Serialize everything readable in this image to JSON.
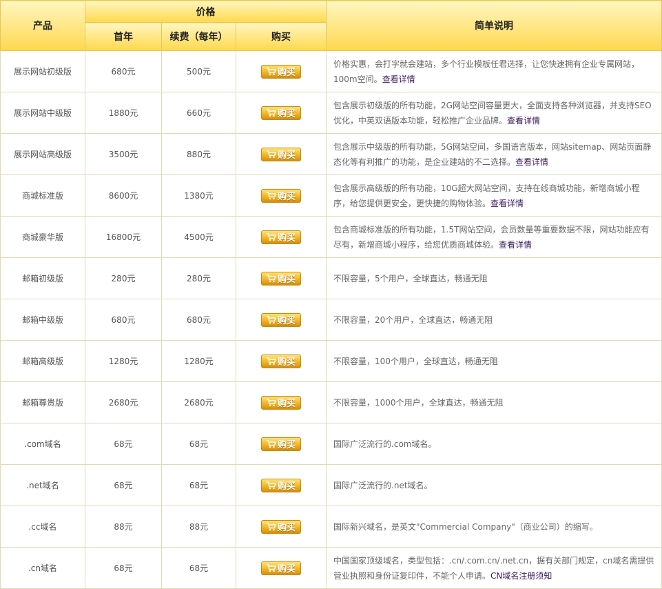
{
  "header": {
    "product": "产品",
    "price": "价格",
    "first_year": "首年",
    "renewal": "续费（每年）",
    "buy": "购买",
    "desc": "简单说明"
  },
  "buy_label": "购买",
  "rows": [
    {
      "name": "展示网站初级版",
      "first": "680元",
      "renew": "500元",
      "desc": "价格实惠，会打字就会建站，多个行业模板任君选择，让您快速拥有企业专属网站，100m空间。",
      "link": "查看详情"
    },
    {
      "name": "展示网站中级版",
      "first": "1880元",
      "renew": "660元",
      "desc": "包含展示初级版的所有功能，2G网站空间容量更大，全面支持各种浏览器，并支持SEO优化，中英双语版本功能，轻松推广企业品牌。",
      "link": "查看详情"
    },
    {
      "name": "展示网站高级版",
      "first": "3500元",
      "renew": "880元",
      "desc": "包含展示中级版的所有功能，5G网站空间，多国语言版本，网站sitemap、网站页面静态化等有利推广的功能，是企业建站的不二选择。",
      "link": "查看详情"
    },
    {
      "name": "商城标准版",
      "first": "8600元",
      "renew": "1380元",
      "desc": "包含展示高级版的所有功能，10G超大网站空间，支持在线商城功能，新增商城小程序，给您提供更安全，更快捷的购物体验。",
      "link": "查看详情"
    },
    {
      "name": "商城豪华版",
      "first": "16800元",
      "renew": "4500元",
      "desc": "包含商城标准版的所有功能，1.5T网站空间，会员数量等重要数据不限，网站功能应有尽有，新增商城小程序，给您优质商城体验。",
      "link": "查看详情"
    },
    {
      "name": "邮箱初级版",
      "first": "280元",
      "renew": "280元",
      "desc": "不限容量，5个用户，全球直达，畅通无阻",
      "link": ""
    },
    {
      "name": "邮箱中级版",
      "first": "680元",
      "renew": "680元",
      "desc": "不限容量，20个用户，全球直达，畅通无阻",
      "link": ""
    },
    {
      "name": "邮箱高级版",
      "first": "1280元",
      "renew": "1280元",
      "desc": "不限容量，100个用户，全球直达，畅通无阻",
      "link": ""
    },
    {
      "name": "邮箱尊贵版",
      "first": "2680元",
      "renew": "2680元",
      "desc": "不限容量，1000个用户，全球直达，畅通无阻",
      "link": ""
    },
    {
      "name": ".com域名",
      "first": "68元",
      "renew": "68元",
      "desc": "国际广泛流行的.com域名。",
      "link": ""
    },
    {
      "name": ".net域名",
      "first": "68元",
      "renew": "68元",
      "desc": "国际广泛流行的.net域名。",
      "link": ""
    },
    {
      "name": ".cc域名",
      "first": "88元",
      "renew": "88元",
      "desc": "国际新兴域名，是英文\"Commercial Company\"（商业公司）的缩写。",
      "link": ""
    },
    {
      "name": ".cn域名",
      "first": "68元",
      "renew": "68元",
      "desc": "中国国家顶级域名，类型包括：.cn/.com.cn/.net.cn，据有关部门规定，cn域名需提供营业执照和身份证复印件，不能个人申请。",
      "link": "CN域名注册须知"
    }
  ]
}
